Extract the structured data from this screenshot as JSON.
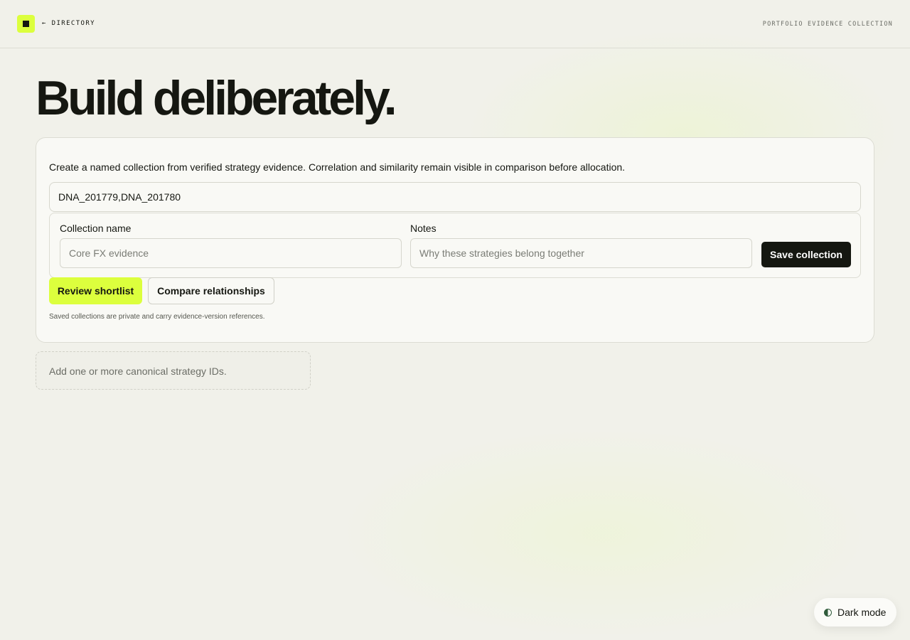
{
  "header": {
    "back_label": "← DIRECTORY",
    "section_label": "PORTFOLIO EVIDENCE COLLECTION"
  },
  "hero": {
    "title": "Build deliberately."
  },
  "card": {
    "intro": "Create a named collection from verified strategy evidence. Correlation and similarity remain visible in comparison before allocation.",
    "strategy_ids_value": "DNA_201779,DNA_201780",
    "collection_name": {
      "label": "Collection name",
      "placeholder": "Core FX evidence",
      "value": ""
    },
    "notes": {
      "label": "Notes",
      "placeholder": "Why these strategies belong together",
      "value": ""
    },
    "save_label": "Save collection",
    "review_label": "Review shortlist",
    "compare_label": "Compare relationships",
    "footnote": "Saved collections are private and carry evidence-version references."
  },
  "empty_state": {
    "message": "Add one or more canonical strategy IDs."
  },
  "theme_toggle": {
    "label": "Dark mode",
    "icon": "half-moon-icon"
  },
  "colors": {
    "accent": "#dcff3d",
    "ink": "#151711",
    "background": "#f1f1ea"
  }
}
